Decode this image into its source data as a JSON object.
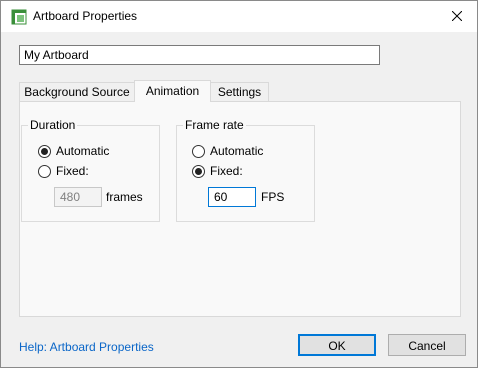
{
  "window": {
    "title": "Artboard Properties"
  },
  "name_field": {
    "value": "My Artboard"
  },
  "tabs": [
    {
      "label": "Background Source",
      "active": false
    },
    {
      "label": "Animation",
      "active": true
    },
    {
      "label": "Settings",
      "active": false
    }
  ],
  "duration": {
    "label": "Duration",
    "automatic_label": "Automatic",
    "fixed_label": "Fixed:",
    "selected": "Automatic",
    "frames_value": "480",
    "frames_unit": "frames"
  },
  "frame_rate": {
    "label": "Frame rate",
    "automatic_label": "Automatic",
    "fixed_label": "Fixed:",
    "selected": "Fixed",
    "fps_value": "60",
    "fps_unit": "FPS"
  },
  "footer": {
    "help_link": "Help: Artboard Properties",
    "ok_label": "OK",
    "cancel_label": "Cancel"
  },
  "colors": {
    "accent": "#0078d7",
    "link": "#0a66c8"
  },
  "icons": {
    "app": "artboard-app-icon",
    "close": "close-icon"
  }
}
